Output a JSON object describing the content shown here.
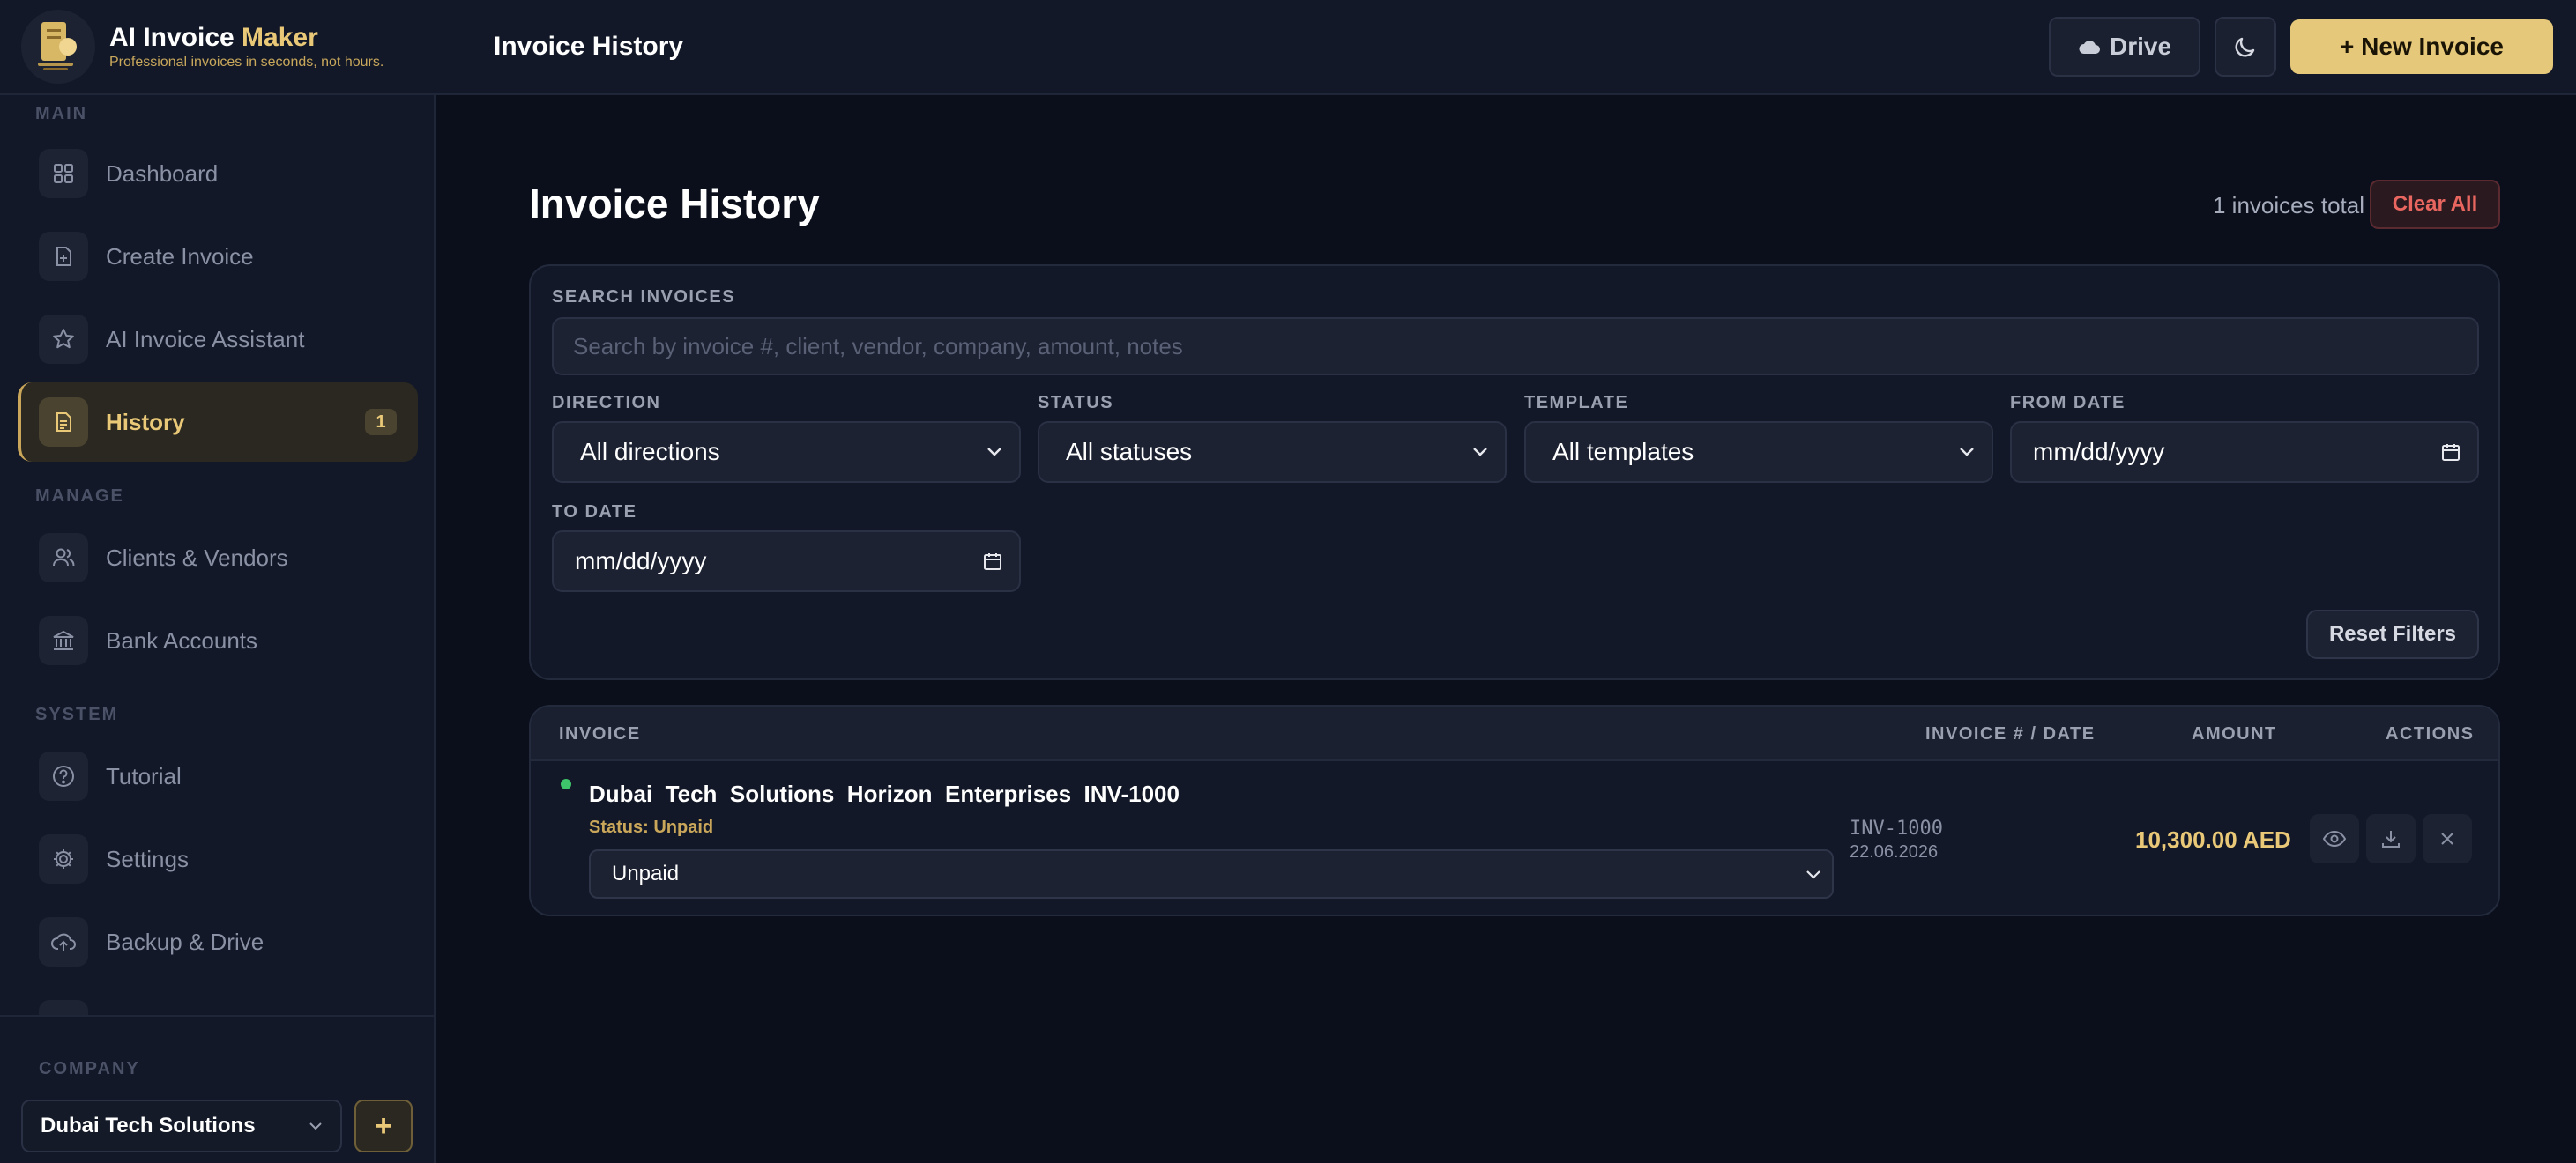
{
  "app": {
    "brand_title_main": "AI Invoice ",
    "brand_title_accent": "Maker",
    "brand_subtitle": "Professional invoices in seconds, not hours.",
    "page_title": "Invoice History"
  },
  "topbar": {
    "drive_label": "Drive",
    "new_invoice_label": "+ New Invoice"
  },
  "sidebar": {
    "sections": {
      "main": "MAIN",
      "manage": "MANAGE",
      "system": "SYSTEM",
      "company": "COMPANY"
    },
    "items": [
      {
        "label": "Dashboard",
        "icon": "grid-icon"
      },
      {
        "label": "Create Invoice",
        "icon": "file-plus-icon"
      },
      {
        "label": "AI Invoice Assistant",
        "icon": "star-icon"
      },
      {
        "label": "History",
        "icon": "document-icon",
        "badge": "1",
        "active": true
      },
      {
        "label": "Clients & Vendors",
        "icon": "users-icon"
      },
      {
        "label": "Bank Accounts",
        "icon": "bank-icon"
      },
      {
        "label": "Tutorial",
        "icon": "help-icon"
      },
      {
        "label": "Settings",
        "icon": "gear-icon"
      },
      {
        "label": "Backup & Drive",
        "icon": "cloud-upload-icon"
      }
    ],
    "company_name": "Dubai Tech Solutions",
    "company_add_label": "+"
  },
  "main": {
    "title": "Invoice History",
    "total_text": "1 invoices total",
    "clear_all_label": "Clear All",
    "filters": {
      "search_label": "SEARCH INVOICES",
      "search_placeholder": "Search by invoice #, client, vendor, company, amount, notes",
      "direction_label": "DIRECTION",
      "direction_value": "All directions",
      "status_label": "STATUS",
      "status_value": "All statuses",
      "template_label": "TEMPLATE",
      "template_value": "All templates",
      "from_date_label": "FROM DATE",
      "from_date_value": "mm/dd/yyyy",
      "to_date_label": "TO DATE",
      "to_date_value": "mm/dd/yyyy",
      "reset_label": "Reset Filters"
    },
    "table": {
      "columns": [
        "INVOICE",
        "INVOICE # / DATE",
        "AMOUNT",
        "ACTIONS"
      ],
      "rows": [
        {
          "name": "Dubai_Tech_Solutions_Horizon_Enterprises_INV-1000",
          "status_text": "Status: Unpaid",
          "status_select": "Unpaid",
          "number": "INV-1000",
          "date": "22.06.2026",
          "amount": "10,300.00 AED"
        }
      ]
    }
  },
  "colors": {
    "accent": "#e9c878",
    "background": "#0b0f1c",
    "panel": "#121827",
    "danger": "#e8665f",
    "success": "#3ec46a"
  }
}
